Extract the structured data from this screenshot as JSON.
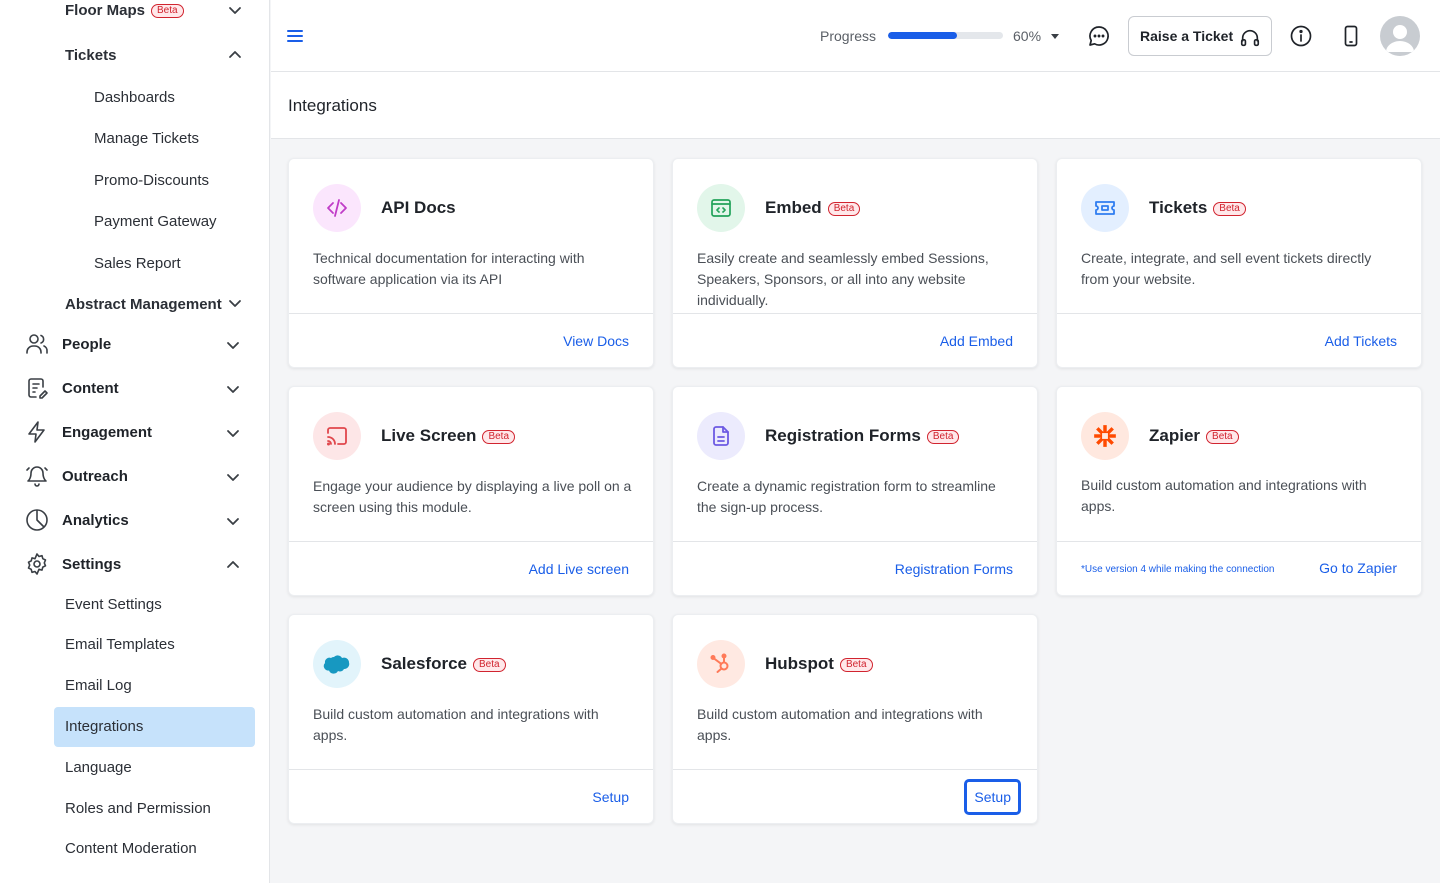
{
  "sidebar": {
    "floor_maps": {
      "label": "Floor Maps",
      "badge": "Beta"
    },
    "tickets": {
      "label": "Tickets"
    },
    "ticket_items": [
      "Dashboards",
      "Manage Tickets",
      "Promo-Discounts",
      "Payment Gateway",
      "Sales Report"
    ],
    "abstract": {
      "label": "Abstract Management"
    },
    "sections": [
      {
        "label": "People",
        "icon": "people-icon"
      },
      {
        "label": "Content",
        "icon": "content-icon"
      },
      {
        "label": "Engagement",
        "icon": "lightning-icon"
      },
      {
        "label": "Outreach",
        "icon": "bell-icon"
      },
      {
        "label": "Analytics",
        "icon": "pie-chart-icon"
      },
      {
        "label": "Settings",
        "icon": "gear-icon"
      }
    ],
    "settings_items": [
      "Event Settings",
      "Email Templates",
      "Email Log",
      "Integrations",
      "Language",
      "Roles and Permission",
      "Content Moderation"
    ],
    "active_item": "Integrations"
  },
  "header": {
    "progress_label": "Progress",
    "progress_value": 0.6,
    "progress_text": "60%",
    "raise_ticket_label": "Raise a Ticket"
  },
  "page": {
    "title": "Integrations"
  },
  "cards": [
    {
      "title": "API Docs",
      "badge": "",
      "desc": "Technical documentation for interacting with software application via its API",
      "action": "View Docs",
      "icon": "code-icon",
      "color": "#c03cc8",
      "bg": "#fbe6fd"
    },
    {
      "title": "Embed",
      "badge": "Beta",
      "desc": "Easily create and seamlessly embed Sessions, Speakers, Sponsors, or all into any website individually.",
      "action": "Add Embed",
      "icon": "embed-icon",
      "color": "#22a35a",
      "bg": "#e2f6ea"
    },
    {
      "title": "Tickets",
      "badge": "Beta",
      "desc": "Create, integrate, and sell event tickets directly from your website.",
      "action": "Add Tickets",
      "icon": "ticket-icon",
      "color": "#2f7df0",
      "bg": "#e3efff"
    },
    {
      "title": "Live Screen",
      "badge": "Beta",
      "desc": "Engage your audience by displaying a live poll on a screen using this module.",
      "action": "Add Live screen",
      "icon": "cast-icon",
      "color": "#e0474c",
      "bg": "#fde6e7"
    },
    {
      "title": "Registration Forms",
      "badge": "Beta",
      "desc": "Create a dynamic registration form to streamline the sign-up process.",
      "action": "Registration Forms",
      "icon": "document-icon",
      "color": "#6d5be3",
      "bg": "#ecebfd"
    },
    {
      "title": "Zapier",
      "badge": "Beta",
      "desc": "Build custom automation and integrations with apps.",
      "action": "Go to Zapier",
      "note": "*Use version 4 while making the connection",
      "icon": "zapier-icon",
      "color": "#ff4a00",
      "bg": "#ffe8df"
    },
    {
      "title": "Salesforce",
      "badge": "Beta",
      "desc": "Build custom automation and integrations with apps.",
      "action": "Setup",
      "icon": "salesforce-icon",
      "color": "#1798c1",
      "bg": "#e2f4fb"
    },
    {
      "title": "Hubspot",
      "badge": "Beta",
      "desc": "Build custom automation and integrations with apps.",
      "action": "Setup",
      "icon": "hubspot-icon",
      "color": "#ff7a59",
      "bg": "#ffe9e2"
    }
  ]
}
